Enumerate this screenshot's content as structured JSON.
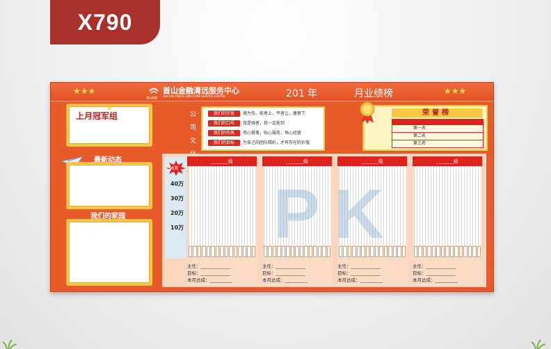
{
  "badge": {
    "text": "X790"
  },
  "header": {
    "company_cn": "首山金融清远服务中心",
    "company_en": "GOCIAN FINACE QINGYUAN SERVICE CENTRE",
    "logo_caption": "首山金融",
    "year_text": "201  年",
    "title": "月业绩榜",
    "stars": "★★★"
  },
  "left": {
    "champion_title": "上月冠军组",
    "news_title": "最新动态",
    "home_title": "我们的家园"
  },
  "culture": {
    "side_label": [
      "公",
      "司",
      "文",
      "化"
    ],
    "rows": [
      {
        "tag": "我们的宗旨",
        "text": "德为先、能者上、平者让、庸者下"
      },
      {
        "tag": "我们的口号",
        "text": "我是强者，我一定能到"
      },
      {
        "tag": "我们的作风",
        "text": "用心做事，贴心服务，恒心经营"
      },
      {
        "tag": "我们的目标",
        "text": "为自己的团队喝彩，才有存在的价值"
      }
    ]
  },
  "honor": {
    "title": "荣誉榜",
    "rows": [
      "第一名",
      "第二名",
      "第三名"
    ]
  },
  "pk": {
    "watermark": "PK",
    "burst": "50万",
    "y_labels": [
      "40万",
      "30万",
      "20万",
      "10万"
    ],
    "group_suffix": "组",
    "footer_labels": [
      "主任：",
      "目标：",
      "本月达成："
    ]
  },
  "colors": {
    "board": "#e85a2a",
    "badge": "#a8312c",
    "accent": "#e0211c",
    "gold": "#f6c843"
  }
}
